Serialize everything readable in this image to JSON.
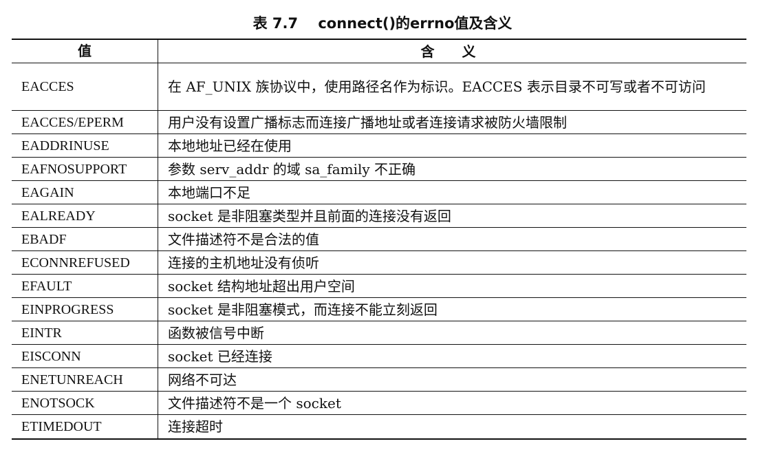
{
  "caption": "表 7.7    connect()的errno值及含义",
  "table": {
    "headers": [
      "值",
      "含　　义"
    ],
    "rows": [
      {
        "code": "EACCES",
        "meaning": "在 AF_UNIX 族协议中，使用路径名作为标识。EACCES 表示目录不可写或者不可访问"
      },
      {
        "code": "EACCES/EPERM",
        "meaning": "用户没有设置广播标志而连接广播地址或者连接请求被防火墙限制"
      },
      {
        "code": "EADDRINUSE",
        "meaning": "本地地址已经在使用"
      },
      {
        "code": "EAFNOSUPPORT",
        "meaning": "参数 serv_addr 的域 sa_family 不正确"
      },
      {
        "code": "EAGAIN",
        "meaning": "本地端口不足"
      },
      {
        "code": "EALREADY",
        "meaning": "socket 是非阻塞类型并且前面的连接没有返回"
      },
      {
        "code": "EBADF",
        "meaning": "文件描述符不是合法的值"
      },
      {
        "code": "ECONNREFUSED",
        "meaning": "连接的主机地址没有侦听"
      },
      {
        "code": "EFAULT",
        "meaning": "socket 结构地址超出用户空间"
      },
      {
        "code": "EINPROGRESS",
        "meaning": "socket 是非阻塞模式，而连接不能立刻返回"
      },
      {
        "code": "EINTR",
        "meaning": "函数被信号中断"
      },
      {
        "code": "EISCONN",
        "meaning": "socket 已经连接"
      },
      {
        "code": "ENETUNREACH",
        "meaning": "网络不可达"
      },
      {
        "code": "ENOTSOCK",
        "meaning": "文件描述符不是一个 socket"
      },
      {
        "code": "ETIMEDOUT",
        "meaning": "连接超时"
      }
    ]
  }
}
